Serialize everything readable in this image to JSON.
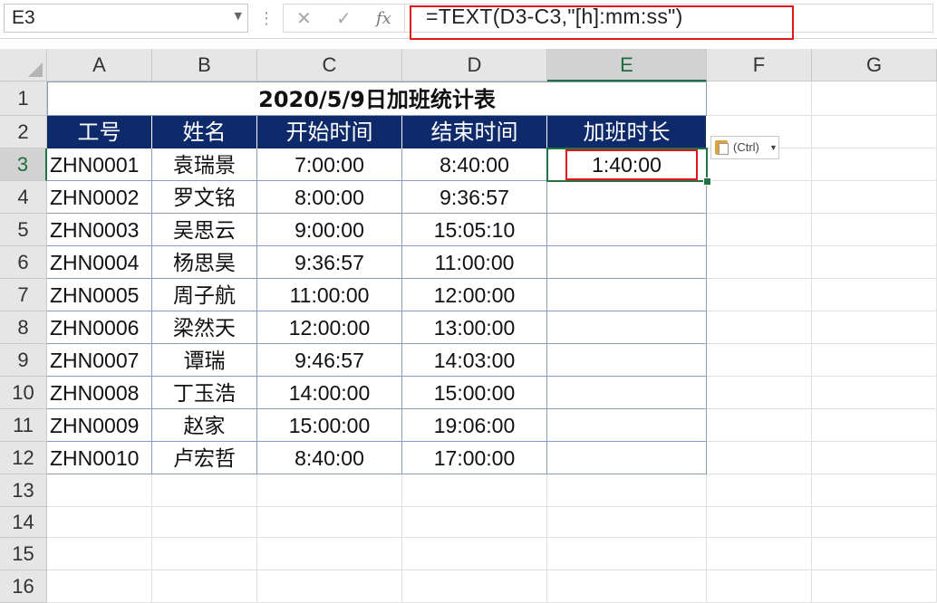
{
  "name_box": {
    "value": "E3"
  },
  "formula_bar": {
    "formula": "=TEXT(D3-C3,\"[h]:mm:ss\")",
    "cancel_icon": "✕",
    "enter_icon": "✓",
    "fx_icon": "fx"
  },
  "columns": [
    "A",
    "B",
    "C",
    "D",
    "E",
    "F",
    "G"
  ],
  "rows": [
    "1",
    "2",
    "3",
    "4",
    "5",
    "6",
    "7",
    "8",
    "9",
    "10",
    "11",
    "12",
    "13",
    "14",
    "15",
    "16"
  ],
  "table": {
    "title": "2020/5/9日加班统计表",
    "headers": [
      "工号",
      "姓名",
      "开始时间",
      "结束时间",
      "加班时长"
    ],
    "rows": [
      [
        "ZHN0001",
        "袁瑞景",
        "7:00:00",
        "8:40:00",
        "1:40:00"
      ],
      [
        "ZHN0002",
        "罗文铭",
        "8:00:00",
        "9:36:57",
        ""
      ],
      [
        "ZHN0003",
        "吴思云",
        "9:00:00",
        "15:05:10",
        ""
      ],
      [
        "ZHN0004",
        "杨思昊",
        "9:36:57",
        "11:00:00",
        ""
      ],
      [
        "ZHN0005",
        "周子航",
        "11:00:00",
        "12:00:00",
        ""
      ],
      [
        "ZHN0006",
        "梁然天",
        "12:00:00",
        "13:00:00",
        ""
      ],
      [
        "ZHN0007",
        "谭瑞",
        "9:46:57",
        "14:03:00",
        ""
      ],
      [
        "ZHN0008",
        "丁玉浩",
        "14:00:00",
        "15:00:00",
        ""
      ],
      [
        "ZHN0009",
        "赵家",
        "15:00:00",
        "19:06:00",
        ""
      ],
      [
        "ZHN0010",
        "卢宏哲",
        "8:40:00",
        "17:00:00",
        ""
      ]
    ]
  },
  "paste_options": {
    "label": "(Ctrl)"
  },
  "colors": {
    "header_fill": "#0f2a6b",
    "highlight": "#e0161b",
    "selection": "#217346"
  }
}
